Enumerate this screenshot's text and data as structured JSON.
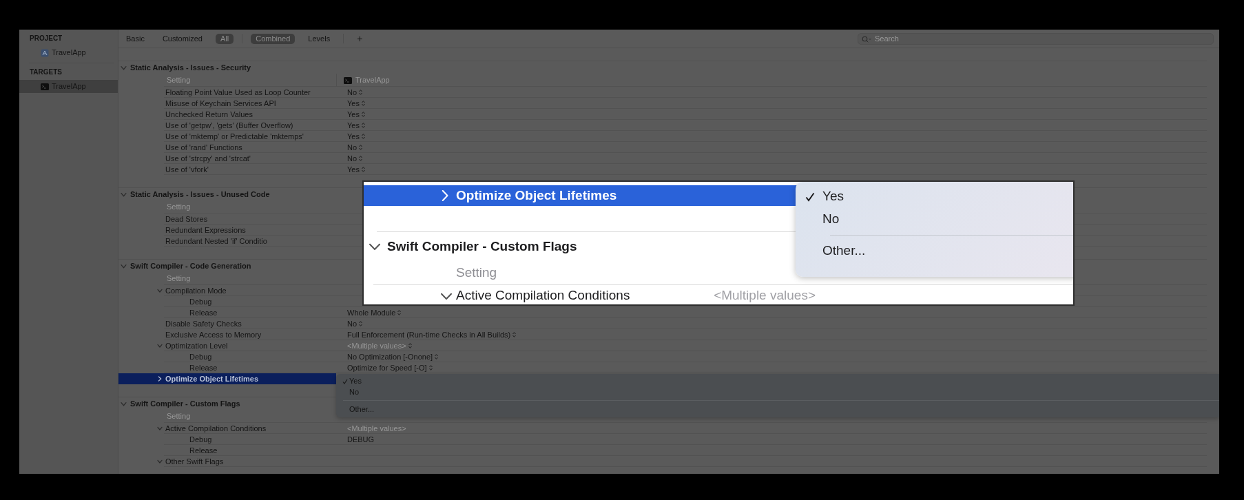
{
  "sidebar": {
    "sections": [
      {
        "title": "PROJECT",
        "items": [
          {
            "label": "TravelApp",
            "selected": false
          }
        ]
      },
      {
        "title": "TARGETS",
        "items": [
          {
            "label": "TravelApp",
            "selected": true
          }
        ]
      }
    ]
  },
  "filter_bar": {
    "scope_tabs": [
      {
        "label": "Basic",
        "selected": false
      },
      {
        "label": "Customized",
        "selected": false
      },
      {
        "label": "All",
        "selected": true
      }
    ],
    "view_tabs": [
      {
        "label": "Combined",
        "selected": true
      },
      {
        "label": "Levels",
        "selected": false
      }
    ],
    "add_button": "+",
    "search": {
      "placeholder": "Search"
    }
  },
  "sections": [
    {
      "title": "Static Analysis - Issues - Security",
      "expanded": true,
      "header": {
        "setting": "Setting",
        "target": "TravelApp"
      },
      "rows": [
        {
          "name": "Floating Point Value Used as Loop Counter",
          "value": "No",
          "popup": true,
          "mixed": false,
          "selected": false
        },
        {
          "name": "Misuse of Keychain Services API",
          "value": "Yes",
          "popup": true,
          "mixed": false,
          "selected": false
        },
        {
          "name": "Unchecked Return Values",
          "value": "Yes",
          "popup": true,
          "mixed": false,
          "selected": false
        },
        {
          "name": "Use of 'getpw', 'gets' (Buffer Overflow)",
          "value": "Yes",
          "popup": true,
          "mixed": false,
          "selected": false
        },
        {
          "name": "Use of 'mktemp' or Predictable 'mktemps'",
          "value": "Yes",
          "popup": true,
          "mixed": false,
          "selected": false
        },
        {
          "name": "Use of 'rand' Functions",
          "value": "No",
          "popup": true,
          "mixed": false,
          "selected": false
        },
        {
          "name": "Use of 'strcpy' and 'strcat'",
          "value": "No",
          "popup": true,
          "mixed": false,
          "selected": false
        },
        {
          "name": "Use of 'vfork'",
          "value": "Yes",
          "popup": true,
          "mixed": false,
          "selected": false
        }
      ]
    },
    {
      "title": "Static Analysis - Issues - Unused Code",
      "expanded": true,
      "header": {
        "setting": "Setting"
      },
      "rows": [
        {
          "name": "Dead Stores",
          "selected": false
        },
        {
          "name": "Redundant Expressions",
          "selected": false
        },
        {
          "name": "Redundant Nested 'if' Conditio",
          "selected": false
        }
      ]
    },
    {
      "title": "Swift Compiler - Code Generation",
      "expanded": true,
      "header": {
        "setting": "Setting"
      },
      "rows": [
        {
          "name": "Compilation Mode",
          "expanded": true,
          "selected": false,
          "children": [
            {
              "name": "Debug",
              "selected": false
            },
            {
              "name": "Release",
              "value": "Whole Module",
              "popup": true,
              "mixed": false,
              "selected": false
            }
          ]
        },
        {
          "name": "Disable Safety Checks",
          "value": "No",
          "popup": true,
          "mixed": false,
          "selected": false
        },
        {
          "name": "Exclusive Access to Memory",
          "value": "Full Enforcement (Run-time Checks in All Builds)",
          "popup": true,
          "mixed": false,
          "selected": false
        },
        {
          "name": "Optimization Level",
          "value": "<Multiple values>",
          "popup": true,
          "mixed": true,
          "expanded": true,
          "selected": false,
          "children": [
            {
              "name": "Debug",
              "value": "No Optimization [-Onone]",
              "popup": true,
              "mixed": false,
              "selected": false
            },
            {
              "name": "Release",
              "value": "Optimize for Speed [-O]",
              "popup": true,
              "mixed": false,
              "selected": false
            }
          ]
        },
        {
          "name": "Optimize Object Lifetimes",
          "expanded": false,
          "selected": true,
          "menu": {
            "items": [
              {
                "kind": "item",
                "label": "Yes",
                "checked": true
              },
              {
                "kind": "item",
                "label": "No",
                "checked": false
              },
              {
                "kind": "separator"
              },
              {
                "kind": "item",
                "label": "Other...",
                "checked": false
              }
            ]
          }
        }
      ]
    },
    {
      "title": "Swift Compiler - Custom Flags",
      "expanded": true,
      "header": {
        "setting": "Setting"
      },
      "rows": [
        {
          "name": "Active Compilation Conditions",
          "value": "<Multiple values>",
          "popup": false,
          "mixed": true,
          "expanded": true,
          "selected": false,
          "children": [
            {
              "name": "Debug",
              "value": "DEBUG",
              "popup": false,
              "mixed": false,
              "selected": false
            },
            {
              "name": "Release",
              "selected": false
            }
          ]
        },
        {
          "name": "Other Swift Flags",
          "expanded": true,
          "selected": false
        }
      ]
    }
  ],
  "callout": {
    "rows": [
      {
        "kind": "setting",
        "name": "Optimize Object Lifetimes",
        "expanded": false,
        "selected": true
      },
      {
        "kind": "section",
        "title": "Swift Compiler - Custom Flags",
        "expanded": true
      },
      {
        "kind": "header",
        "setting": "Setting"
      },
      {
        "kind": "setting",
        "name": "Active Compilation Conditions",
        "expanded": true,
        "selected": false,
        "value": "<Multiple values>",
        "mixed": true
      }
    ],
    "menu": {
      "items": [
        {
          "kind": "item",
          "label": "Yes",
          "checked": true
        },
        {
          "kind": "item",
          "label": "No",
          "checked": false
        },
        {
          "kind": "separator"
        },
        {
          "kind": "item",
          "label": "Other...",
          "checked": false
        }
      ]
    }
  }
}
